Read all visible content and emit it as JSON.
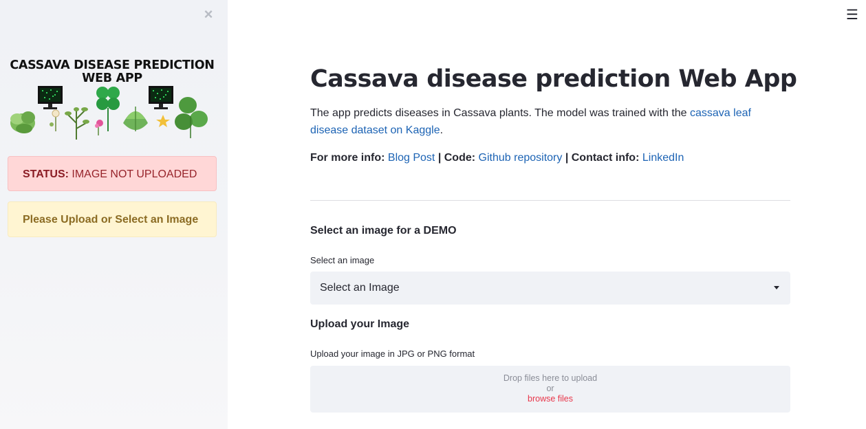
{
  "sidebar": {
    "close_icon": "×",
    "logo_title_line1": "CASSAVA DISEASE PREDICTION",
    "logo_title_line2": "WEB APP",
    "status_label": "STATUS:",
    "status_text": "IMAGE NOT UPLOADED",
    "warning_text": "Please Upload or Select an Image"
  },
  "header": {
    "menu_icon": "☰"
  },
  "main": {
    "title": "Cassava disease prediction Web App",
    "description_prefix": "The app predicts diseases in Cassava plants. The model was trained with the ",
    "description_link": "cassava leaf disease dataset on Kaggle",
    "description_suffix": ".",
    "info": {
      "more_info_label": "For more info:",
      "blog_link": "Blog Post",
      "sep1": " | ",
      "code_label": "Code:",
      "github_link": "Github repository",
      "sep2": " | ",
      "contact_label": "Contact info:",
      "linkedin_link": "LinkedIn"
    },
    "demo_heading": "Select an image for a DEMO",
    "select_label": "Select an image",
    "select_value": "Select an Image",
    "upload_heading": "Upload your Image",
    "upload_label": "Upload your image in JPG or PNG format",
    "dropzone": {
      "line1": "Drop files here to upload",
      "line2": "or",
      "browse": "browse files"
    }
  },
  "colors": {
    "link": "#1c63b4",
    "error_bg": "#ffd7d7",
    "warning_bg": "#fff5d2",
    "browse": "#e8364a",
    "sidebar_bg": "#f0f2f6"
  }
}
